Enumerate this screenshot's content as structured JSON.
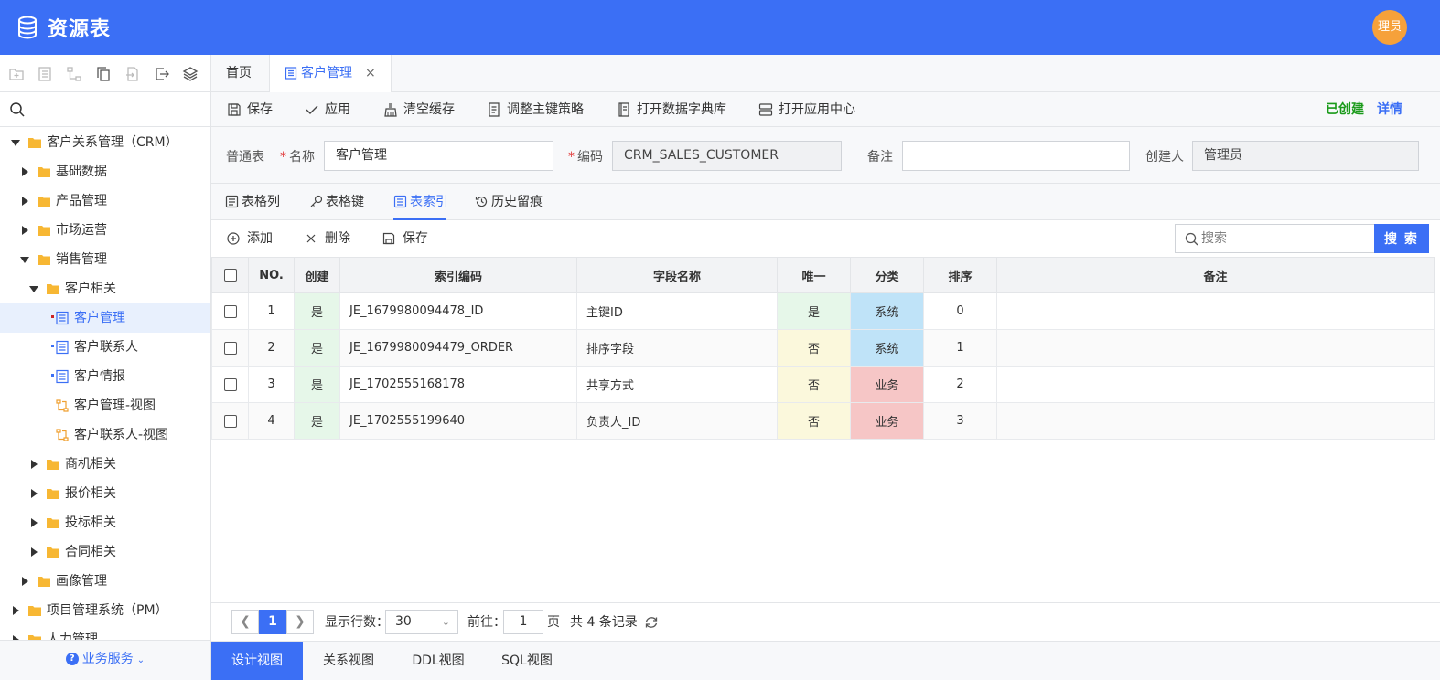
{
  "app": {
    "title": "资源表",
    "avatar_text": "理员"
  },
  "sidebar": {
    "search_placeholder": "",
    "tree": [
      {
        "label": "客户关系管理（CRM）",
        "level": 0,
        "type": "folder",
        "state": "open"
      },
      {
        "label": "基础数据",
        "level": 1,
        "type": "folder",
        "state": "closed"
      },
      {
        "label": "产品管理",
        "level": 1,
        "type": "folder",
        "state": "closed"
      },
      {
        "label": "市场运营",
        "level": 1,
        "type": "folder",
        "state": "closed"
      },
      {
        "label": "销售管理",
        "level": 1,
        "type": "folder",
        "state": "open"
      },
      {
        "label": "客户相关",
        "level": 2,
        "type": "folder",
        "state": "open"
      },
      {
        "label": "客户管理",
        "level": 3,
        "type": "table",
        "state": "selected",
        "marker": "#cc2222"
      },
      {
        "label": "客户联系人",
        "level": 3,
        "type": "table",
        "state": "none",
        "marker": "#3b6ff5"
      },
      {
        "label": "客户情报",
        "level": 3,
        "type": "table",
        "state": "none",
        "marker": "#3b6ff5"
      },
      {
        "label": "客户管理-视图",
        "level": 3,
        "type": "view",
        "state": "none"
      },
      {
        "label": "客户联系人-视图",
        "level": 3,
        "type": "view",
        "state": "none"
      },
      {
        "label": "商机相关",
        "level": 2,
        "type": "folder",
        "state": "closed"
      },
      {
        "label": "报价相关",
        "level": 2,
        "type": "folder",
        "state": "closed"
      },
      {
        "label": "投标相关",
        "level": 2,
        "type": "folder",
        "state": "closed"
      },
      {
        "label": "合同相关",
        "level": 2,
        "type": "folder",
        "state": "closed"
      },
      {
        "label": "画像管理",
        "level": 1,
        "type": "folder",
        "state": "closed"
      },
      {
        "label": "项目管理系统（PM）",
        "level": 0,
        "type": "folder",
        "state": "closed"
      },
      {
        "label": "人力管理",
        "level": 0,
        "type": "folder",
        "state": "closed"
      }
    ],
    "footer_label": "业务服务"
  },
  "tabs": {
    "home": "首页",
    "active": "客户管理"
  },
  "toolbar": {
    "save": "保存",
    "apply": "应用",
    "clear_cache": "清空缓存",
    "adjust_pk": "调整主键策略",
    "open_dict": "打开数据字典库",
    "open_app_center": "打开应用中心",
    "status": "已创建",
    "detail": "详情"
  },
  "form": {
    "table_type": "普通表",
    "name_label": "名称",
    "name_value": "客户管理",
    "code_label": "编码",
    "code_value": "CRM_SALES_CUSTOMER",
    "remark_label": "备注",
    "remark_value": "",
    "creator_label": "创建人",
    "creator_value": "管理员"
  },
  "subtabs": {
    "columns": "表格列",
    "keys": "表格键",
    "indexes": "表索引",
    "history": "历史留痕"
  },
  "actions": {
    "add": "添加",
    "delete": "删除",
    "save": "保存",
    "search_placeholder": "搜索",
    "search_button": "搜 索"
  },
  "grid": {
    "headers": [
      "NO.",
      "创建",
      "索引编码",
      "字段名称",
      "唯一",
      "分类",
      "排序",
      "备注"
    ],
    "rows": [
      {
        "no": "1",
        "created": "是",
        "code": "JE_1679980094478_ID",
        "field": "主键ID",
        "unique": "是",
        "category": "系统",
        "order": "0",
        "remark": ""
      },
      {
        "no": "2",
        "created": "是",
        "code": "JE_1679980094479_ORDER",
        "field": "排序字段",
        "unique": "否",
        "category": "系统",
        "order": "1",
        "remark": ""
      },
      {
        "no": "3",
        "created": "是",
        "code": "JE_1702555168178",
        "field": "共享方式",
        "unique": "否",
        "category": "业务",
        "order": "2",
        "remark": ""
      },
      {
        "no": "4",
        "created": "是",
        "code": "JE_1702555199640",
        "field": "负责人_ID",
        "unique": "否",
        "category": "业务",
        "order": "3",
        "remark": ""
      }
    ],
    "colors": {
      "created_bg": "#e6f7e9",
      "unique_yes_bg": "#e6f7e9",
      "unique_no_bg": "#fbf8dc",
      "category_system_bg": "#bfe3f8",
      "category_business_bg": "#f6c6c6"
    }
  },
  "pager": {
    "current_page": "1",
    "rows_label": "显示行数：",
    "rows_value": "30",
    "goto_label": "前往：",
    "goto_value": "1",
    "page_suffix": "页",
    "total_text": "共 4 条记录"
  },
  "bottom_tabs": [
    "设计视图",
    "关系视图",
    "DDL视图",
    "SQL视图"
  ]
}
